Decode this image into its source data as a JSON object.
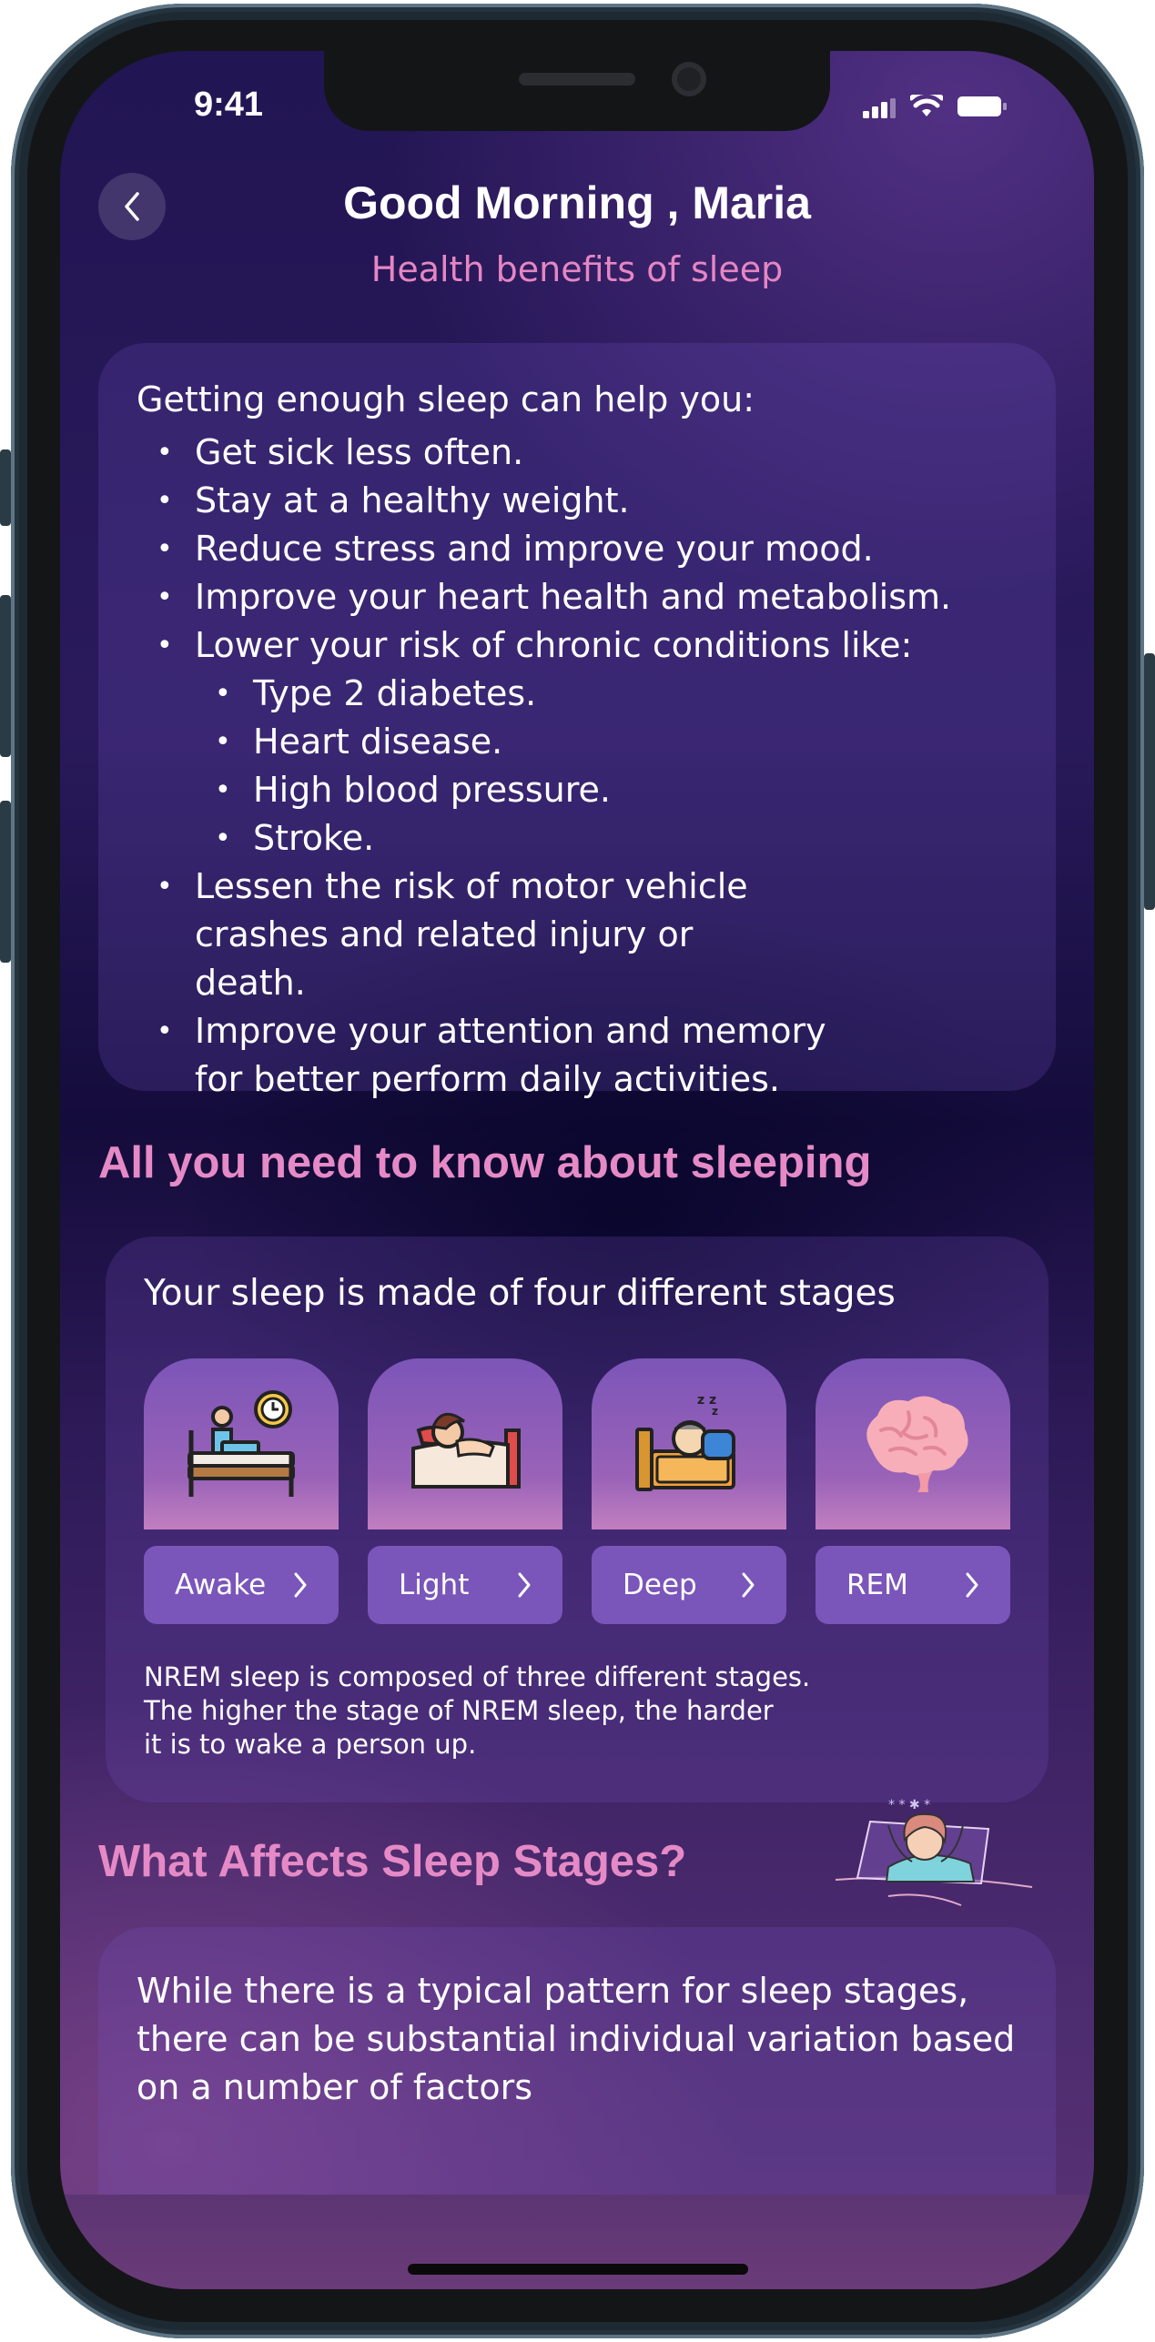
{
  "status": {
    "time": "9:41"
  },
  "header": {
    "title": "Good Morning , Maria",
    "subtitle": "Health benefits of sleep"
  },
  "benefits": {
    "intro": "Getting enough sleep can help you:",
    "items": [
      "Get sick less often.",
      "Stay at a healthy weight.",
      "Reduce stress and improve your mood.",
      "Improve your heart health and metabolism.",
      "Lower your risk of chronic conditions like:",
      "Type 2 diabetes.",
      "Heart disease.",
      "High blood pressure.",
      "Stroke.",
      "Lessen the risk of motor vehicle crashes and related injury or death.",
      "Improve your attention and memory for better perform daily activities."
    ]
  },
  "sleep_section": {
    "heading": "All you need to know about sleeping",
    "card_title": "Your sleep is made of four different stages",
    "stages": [
      {
        "label": "Awake",
        "icon": "awake-bed-clock-icon"
      },
      {
        "label": "Light",
        "icon": "light-sleep-icon"
      },
      {
        "label": "Deep",
        "icon": "deep-sleep-icon"
      },
      {
        "label": "REM",
        "icon": "brain-icon"
      }
    ],
    "note_lines": [
      "NREM sleep is composed of three different stages.",
      "The higher the stage of NREM sleep, the harder",
      "it is to wake a person up."
    ]
  },
  "factors_section": {
    "heading": "What Affects Sleep Stages?",
    "text": "While there is a typical pattern for sleep stages, there can be substantial individual variation based on a number of factors"
  },
  "colors": {
    "accent_pink": "#e586c3",
    "stage_button": "#7a55ba",
    "background_dark": "#140c3b"
  }
}
